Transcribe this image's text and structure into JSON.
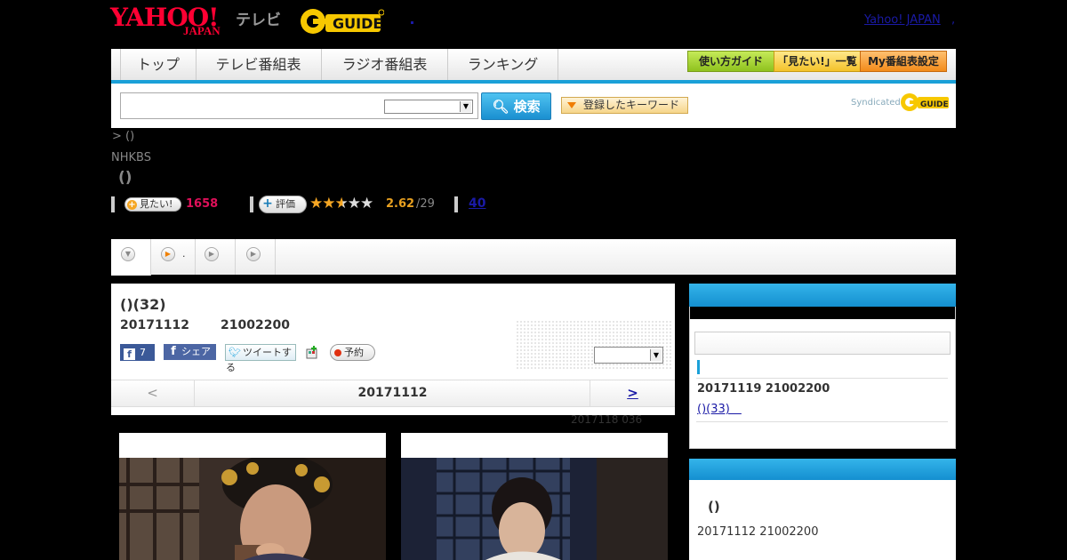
{
  "header": {
    "yahoo_logo": "YAHOO!",
    "japan_logo": "JAPAN",
    "tv_label": "テレビ",
    "gguide_logo": "G GUIDE",
    "yahoo_japan_link": "Yahoo! JAPAN",
    "link_sep": ","
  },
  "nav": {
    "tabs": [
      "トップ",
      "テレビ番組表",
      "ラジオ番組表",
      "ランキング"
    ],
    "guide_buttons": [
      "使い方ガイド",
      "「見たい!」一覧",
      "My番組表設定"
    ]
  },
  "search": {
    "input_value": "",
    "select_value": "",
    "button_label": "検索",
    "keyword_button": "登録したキーワード",
    "syndicated": "Syndicated"
  },
  "program": {
    "breadcrumb": ">  ()",
    "channel": "NHKBS",
    "title": "()",
    "mitai_label": "見たい!",
    "mitai_count": "1658",
    "hyoka_label": "評価",
    "rating_value": 2.62,
    "score": "2.62",
    "score_total": "/29",
    "review_count": "40"
  },
  "tabs": [
    {
      "label": ""
    },
    {
      "label": "."
    },
    {
      "label": ""
    },
    {
      "label": ""
    }
  ],
  "episode": {
    "title": "()(32)",
    "date": "20171112",
    "time": "21002200",
    "fb_like": "7",
    "fb_share": "シェア",
    "tweet": "ツイートする",
    "reserve": "予約",
    "select_value": ""
  },
  "pager": {
    "prev": "<",
    "date": "20171112",
    "next": ">"
  },
  "next_air": "2017118  036",
  "sidebar": {
    "date": "20171119  21002200",
    "link": "()(33)　",
    "box2_title": "()",
    "box2_date": "20171112  21002200"
  },
  "colors": {
    "accent": "#1aa0d8",
    "yahoo_red": "#ff0033",
    "count_red": "#e0105a",
    "star": "#f5a623"
  }
}
